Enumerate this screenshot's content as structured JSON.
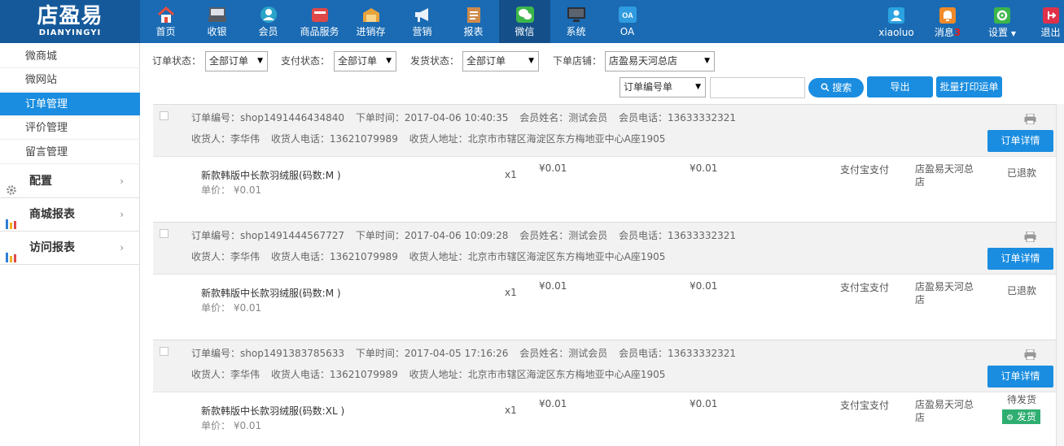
{
  "brand": {
    "name": "店盈易",
    "sub": "DIANYINGYI"
  },
  "nav": [
    {
      "label": "首页",
      "icon": "home-icon",
      "color": "#e74c3c"
    },
    {
      "label": "收银",
      "icon": "cash-register-icon",
      "color": "#555c66"
    },
    {
      "label": "会员",
      "icon": "member-icon",
      "color": "#2aa3c9"
    },
    {
      "label": "商品服务",
      "icon": "goods-icon",
      "color": "#e04848"
    },
    {
      "label": "进销存",
      "icon": "inventory-icon",
      "color": "#e8a33a"
    },
    {
      "label": "营销",
      "icon": "megaphone-icon",
      "color": "#dfe9f5"
    },
    {
      "label": "报表",
      "icon": "report-icon",
      "color": "#cf8a4a"
    },
    {
      "label": "微信",
      "icon": "wechat-icon",
      "color": "#3cb64a"
    },
    {
      "label": "系统",
      "icon": "monitor-icon",
      "color": "#2b2f36"
    },
    {
      "label": "OA",
      "icon": "oa-icon",
      "color": "#2f9be0"
    }
  ],
  "top_right": {
    "user": "xiaoluo",
    "messages_label": "消息",
    "messages_count": "3",
    "settings_label": "设置",
    "logout_label": "退出"
  },
  "sidebar": {
    "items": [
      "微商城",
      "微网站",
      "订单管理",
      "评价管理",
      "留言管理"
    ],
    "active": "订单管理",
    "groups": [
      "配置",
      "商城报表",
      "访问报表"
    ]
  },
  "filters": {
    "order_status_label": "订单状态：",
    "order_status_value": "全部订单",
    "pay_status_label": "支付状态：",
    "pay_status_value": "全部订单",
    "ship_status_label": "发货状态：",
    "ship_status_value": "全部订单",
    "store_label": "下单店铺：",
    "store_value": "店盈易天河总店",
    "search_field_value": "订单编号单",
    "search_input_value": "",
    "search_button": "搜索",
    "export_button": "导出",
    "batch_print_button": "批量打印运单"
  },
  "orders": [
    {
      "order_no": "订单编号：shop1491446434840",
      "time": "下单时间：2017-04-06 10:40:35",
      "member": "会员姓名：测试会员",
      "member_phone": "会员电话：13633332321",
      "receiver": "收货人：李华伟",
      "receiver_phone": "收货人电话：13621079989",
      "address": "收货人地址：北京市市辖区海淀区东方梅地亚中心A座1905",
      "detail_button": "订单详情",
      "product_name": "新款韩版中长款羽绒服(码数:M )",
      "unit_price": "单价： ¥0.01",
      "qty": "x1",
      "amount1": "¥0.01",
      "amount2": "¥0.01",
      "payment": "支付宝支付",
      "store": "店盈易天河总店",
      "status": "已退款",
      "ship_button": ""
    },
    {
      "order_no": "订单编号：shop1491444567727",
      "time": "下单时间：2017-04-06 10:09:28",
      "member": "会员姓名：测试会员",
      "member_phone": "会员电话：13633332321",
      "receiver": "收货人：李华伟",
      "receiver_phone": "收货人电话：13621079989",
      "address": "收货人地址：北京市市辖区海淀区东方梅地亚中心A座1905",
      "detail_button": "订单详情",
      "product_name": "新款韩版中长款羽绒服(码数:M )",
      "unit_price": "单价： ¥0.01",
      "qty": "x1",
      "amount1": "¥0.01",
      "amount2": "¥0.01",
      "payment": "支付宝支付",
      "store": "店盈易天河总店",
      "status": "已退款",
      "ship_button": ""
    },
    {
      "order_no": "订单编号：shop1491383785633",
      "time": "下单时间：2017-04-05 17:16:26",
      "member": "会员姓名：测试会员",
      "member_phone": "会员电话：13633332321",
      "receiver": "收货人：李华伟",
      "receiver_phone": "收货人电话：13621079989",
      "address": "收货人地址：北京市市辖区海淀区东方梅地亚中心A座1905",
      "detail_button": "订单详情",
      "product_name": "新款韩版中长款羽绒服(码数:XL )",
      "unit_price": "单价： ¥0.01",
      "qty": "x1",
      "amount1": "¥0.01",
      "amount2": "¥0.01",
      "payment": "支付宝支付",
      "store": "店盈易天河总店",
      "status": "待发货",
      "ship_button": "发货"
    }
  ],
  "colors": {
    "topbar": "#1a6bb4",
    "accent": "#1a8de0",
    "ship": "#2eae70"
  }
}
